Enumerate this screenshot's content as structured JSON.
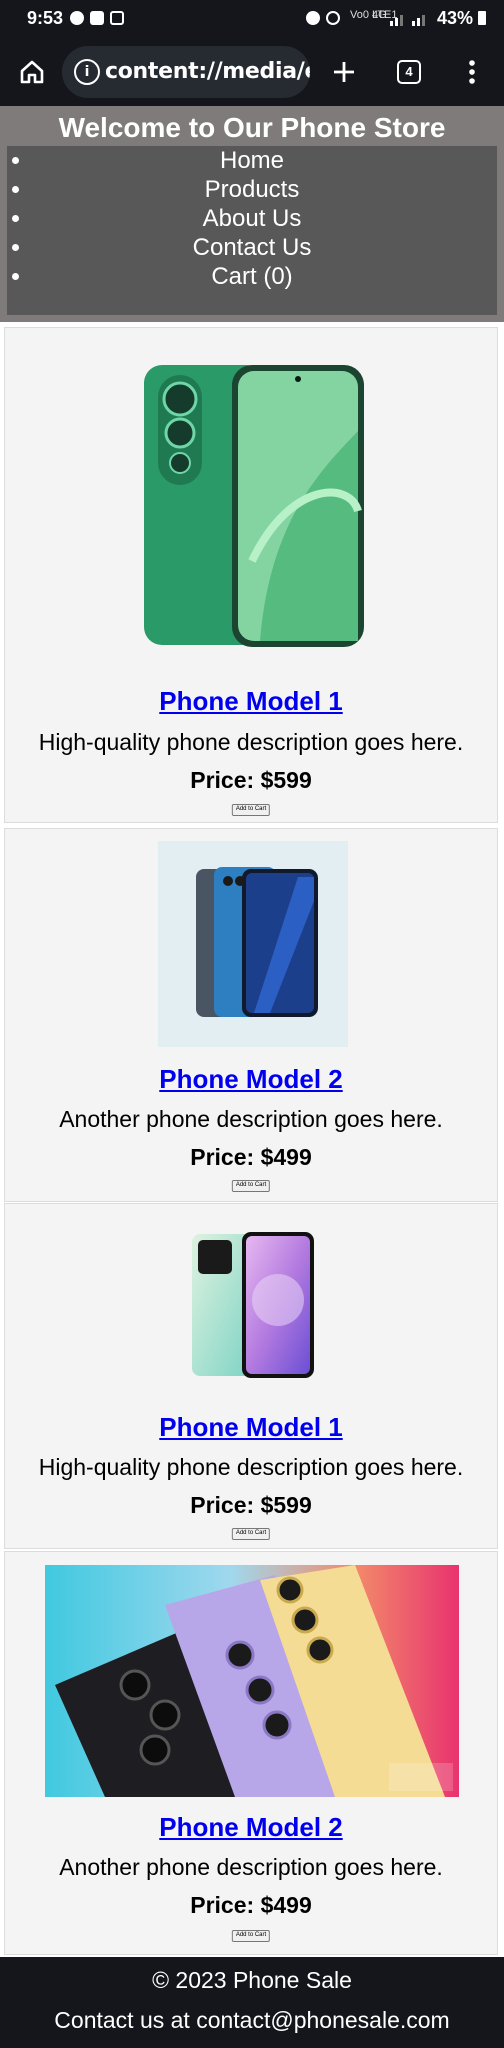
{
  "status_bar": {
    "time": "9:53",
    "network": "Vo0 LTE1",
    "network_type": "4G",
    "battery": "43%"
  },
  "browser": {
    "url": "content://media/ex",
    "tab_count": "4"
  },
  "site": {
    "title": "Welcome to Our Phone Store",
    "nav": [
      "Home",
      "Products",
      "About Us",
      "Contact Us",
      "Cart (0)"
    ]
  },
  "products": [
    {
      "name": "Phone Model 1",
      "description": "High-quality phone description goes here.",
      "price": "Price: $599",
      "button": "Add to Cart",
      "image": "green-phone"
    },
    {
      "name": "Phone Model 2",
      "description": "Another phone description goes here.",
      "price": "Price: $499",
      "button": "Add to Cart",
      "image": "blue-phone"
    },
    {
      "name": "Phone Model 1",
      "description": "High-quality phone description goes here.",
      "price": "Price: $599",
      "button": "Add to Cart",
      "image": "redmi-phone"
    },
    {
      "name": "Phone Model 2",
      "description": "Another phone description goes here.",
      "price": "Price: $499",
      "button": "Add to Cart",
      "image": "galaxy-phones",
      "image_watermark": "PHONE ARENA"
    }
  ],
  "footer": {
    "copyright": "© 2023 Phone Sale",
    "contact": "Contact us at contact@phonesale.com"
  }
}
